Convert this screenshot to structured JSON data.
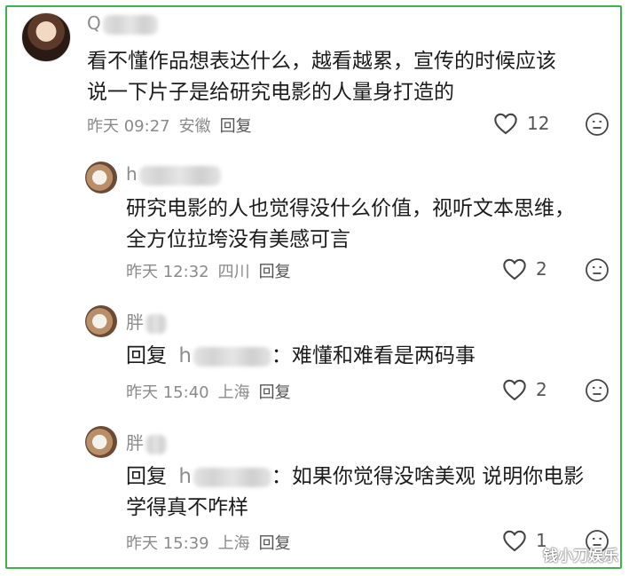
{
  "comments": [
    {
      "username": "Q",
      "text_lines": [
        "看不懂作品想表达什么，越看越累，宣传的时候应该",
        "说一下片子是给研究电影的人量身打造的"
      ],
      "time": "昨天 09:27",
      "location": "安徽",
      "reply_label": "回复",
      "likes": "12"
    },
    {
      "username": "h",
      "text_lines": [
        "研究电影的人也觉得没什么价值，视听文本思维，",
        "全方位拉垮没有美感可言"
      ],
      "time": "昨天 12:32",
      "location": "四川",
      "reply_label": "回复",
      "likes": "2"
    },
    {
      "username": "胖",
      "reply_prefix": "回复",
      "reply_target": "h",
      "text_lines": [
        "：难懂和难看是两码事"
      ],
      "time": "昨天 15:40",
      "location": "上海",
      "reply_label": "回复",
      "likes": "2"
    },
    {
      "username": "胖",
      "reply_prefix": "回复",
      "reply_target": "h",
      "text_lines": [
        "：如果你觉得没啥美观 说明你电影",
        "学得真不咋样"
      ],
      "time": "昨天 15:39",
      "location": "上海",
      "reply_label": "回复",
      "likes": "1"
    }
  ],
  "watermark": "钱小刀娱乐",
  "colors": {
    "border": "#3bb54a",
    "meta": "#8a8a8a"
  },
  "icons": {
    "like": "heart-outline-icon",
    "emoji": "emoji-face-icon"
  }
}
